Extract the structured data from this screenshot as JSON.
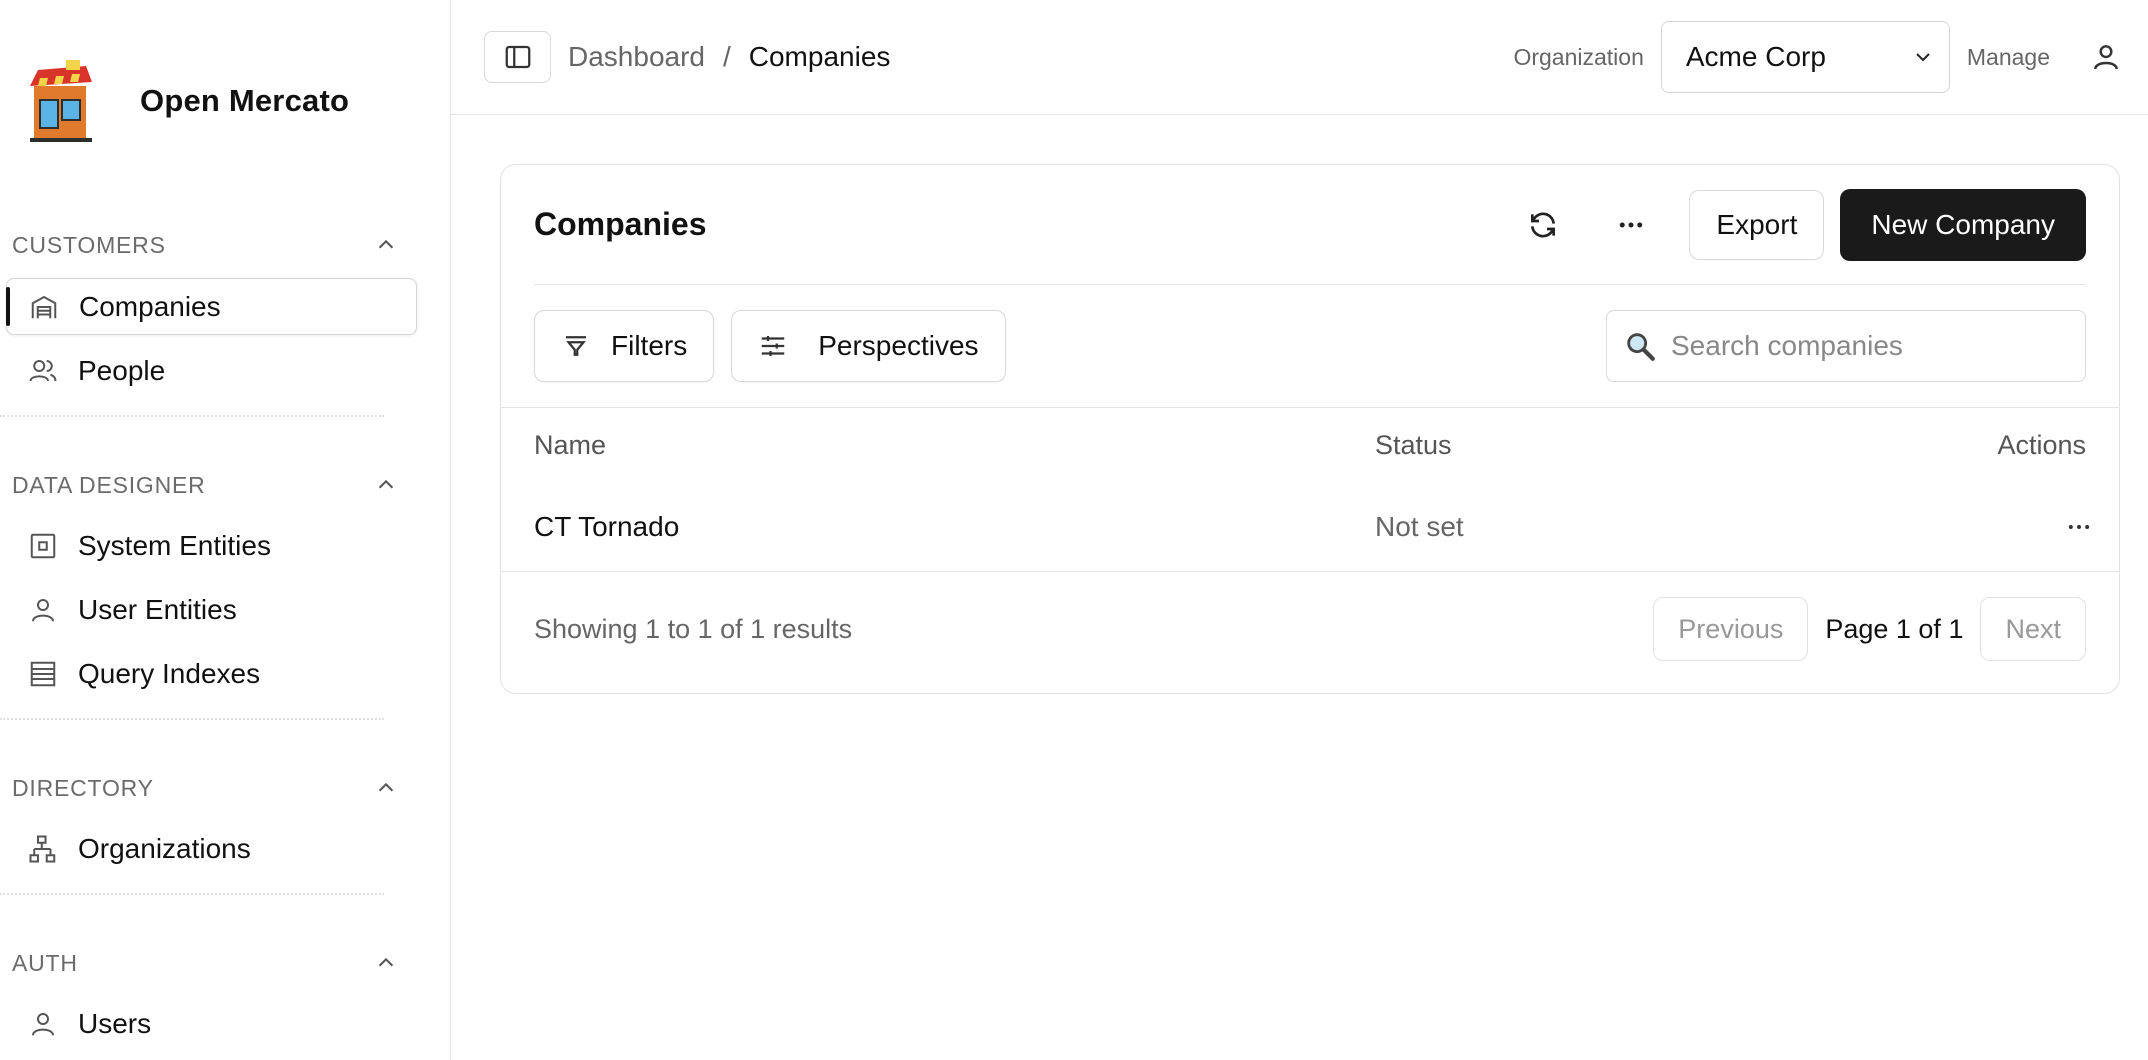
{
  "brand": {
    "name": "Open Mercato"
  },
  "sidebar": {
    "sections": [
      {
        "title": "CUSTOMERS",
        "items": [
          {
            "label": "Companies",
            "icon": "building-icon",
            "active": true
          },
          {
            "label": "People",
            "icon": "users-icon"
          }
        ]
      },
      {
        "title": "DATA DESIGNER",
        "items": [
          {
            "label": "System Entities",
            "icon": "square-dot-icon"
          },
          {
            "label": "User Entities",
            "icon": "user-icon"
          },
          {
            "label": "Query Indexes",
            "icon": "stack-icon"
          }
        ]
      },
      {
        "title": "DIRECTORY",
        "items": [
          {
            "label": "Organizations",
            "icon": "org-tree-icon"
          }
        ]
      },
      {
        "title": "AUTH",
        "items": [
          {
            "label": "Users",
            "icon": "user-icon"
          }
        ]
      }
    ]
  },
  "header": {
    "breadcrumb": {
      "parent": "Dashboard",
      "separator": "/",
      "current": "Companies"
    },
    "org_label": "Organization",
    "org_value": "Acme Corp",
    "manage_label": "Manage"
  },
  "card": {
    "title": "Companies",
    "export_label": "Export",
    "new_label": "New Company",
    "filters_label": "Filters",
    "perspectives_label": "Perspectives",
    "search_placeholder": "Search companies",
    "columns": {
      "name": "Name",
      "status": "Status",
      "actions": "Actions"
    },
    "rows": [
      {
        "name": "CT Tornado",
        "status": "Not set",
        "actions": "..."
      }
    ],
    "footer": {
      "showing": "Showing 1 to 1 of 1 results",
      "previous": "Previous",
      "page": "Page 1 of 1",
      "next": "Next"
    }
  },
  "colors": {
    "primary_button": "#1a1a1a",
    "border": "#e2e2e2",
    "muted_text": "#666666"
  }
}
